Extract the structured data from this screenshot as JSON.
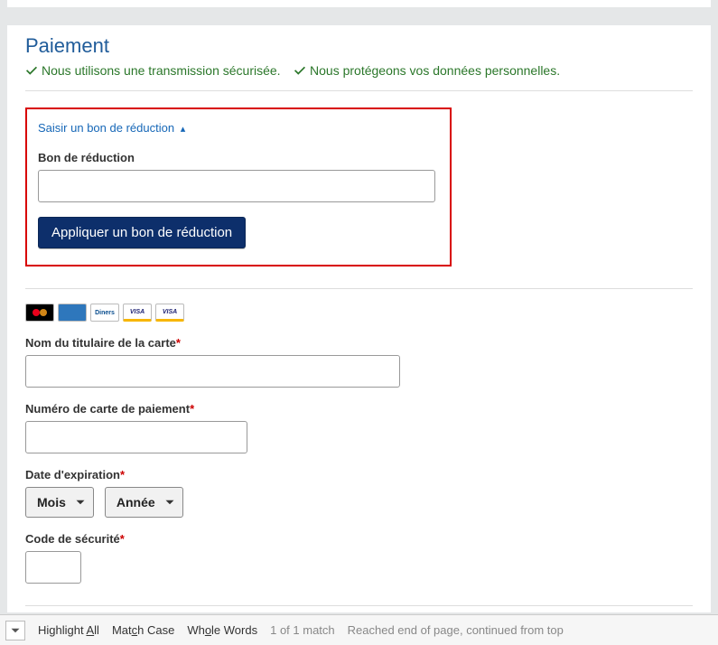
{
  "panel": {
    "title": "Paiement",
    "security": {
      "transmission": "Nous utilisons une transmission sécurisée.",
      "protection": "Nous protégeons vos données personnelles."
    }
  },
  "coupon": {
    "toggle": "Saisir un bon de réduction",
    "label": "Bon de réduction",
    "apply": "Appliquer un bon de réduction"
  },
  "cards": {
    "mastercard": "MC",
    "amex": "AMEX",
    "diners": "Diners",
    "visa": "VISA",
    "visa_electron": "VISA"
  },
  "form": {
    "cardholder_label": "Nom du titulaire de la carte",
    "cardnumber_label": "Numéro de carte de paiement",
    "expiry_label": "Date d'expiration",
    "month": "Mois",
    "year": "Année",
    "cvv_label": "Code de sécurité"
  },
  "findbar": {
    "highlight_pre": "Highlight ",
    "highlight_ul": "A",
    "highlight_post": "ll",
    "matchcase_pre": "Mat",
    "matchcase_ul": "c",
    "matchcase_post": "h Case",
    "whole_pre": "Wh",
    "whole_ul": "o",
    "whole_post": "le Words",
    "count": "1 of 1 match",
    "status": "Reached end of page, continued from top"
  }
}
